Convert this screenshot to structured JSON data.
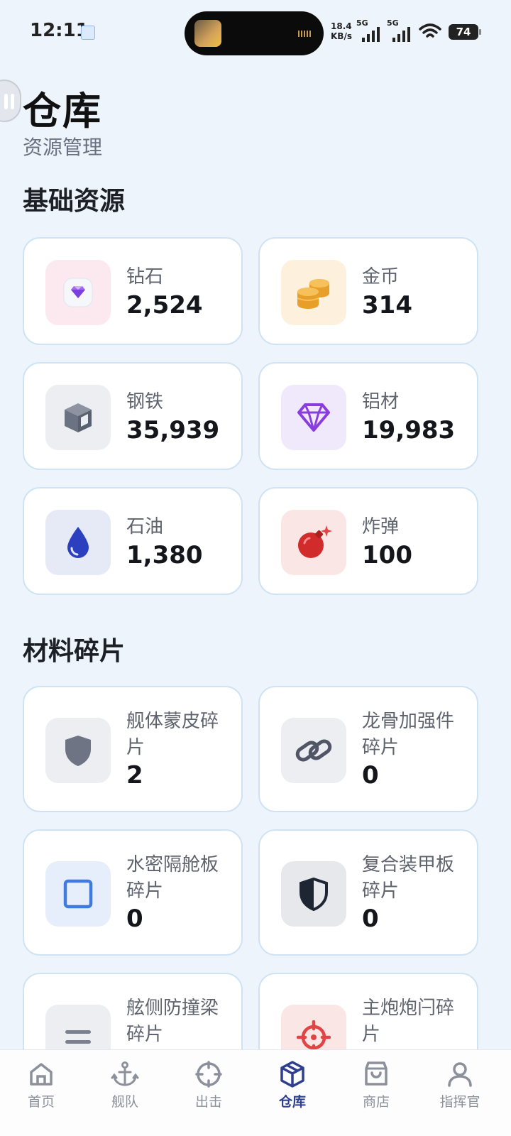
{
  "status_bar": {
    "time": "12:11",
    "net_speed_value": "18.4",
    "net_speed_unit": "KB/s",
    "sim1_type": "5G",
    "sim2_type": "5G",
    "battery": "74"
  },
  "header": {
    "title": "仓库",
    "subtitle": "资源管理"
  },
  "sections": {
    "basic": {
      "title": "基础资源",
      "items": [
        {
          "label": "钻石",
          "value": "2,524",
          "icon": "gem-icon",
          "tile_color": "#fbe9ef"
        },
        {
          "label": "金币",
          "value": "314",
          "icon": "coins-icon",
          "tile_color": "#fdf0dc"
        },
        {
          "label": "钢铁",
          "value": "35,939",
          "icon": "cube-icon",
          "tile_color": "#eceef2"
        },
        {
          "label": "铝材",
          "value": "19,983",
          "icon": "diamond-outline-icon",
          "tile_color": "#f0e8fb"
        },
        {
          "label": "石油",
          "value": "1,380",
          "icon": "oil-drop-icon",
          "tile_color": "#e6eaf7"
        },
        {
          "label": "炸弹",
          "value": "100",
          "icon": "bomb-icon",
          "tile_color": "#fbe6e6"
        }
      ]
    },
    "fragments": {
      "title": "材料碎片",
      "items": [
        {
          "label": "舰体蒙皮碎片",
          "value": "2",
          "icon": "shield-icon",
          "tile_color": "#eceef2"
        },
        {
          "label": "龙骨加强件碎片",
          "value": "0",
          "icon": "link-icon",
          "tile_color": "#eceef2"
        },
        {
          "label": "水密隔舱板碎片",
          "value": "0",
          "icon": "square-outline-icon",
          "tile_color": "#e6eefb"
        },
        {
          "label": "复合装甲板碎片",
          "value": "0",
          "icon": "half-shield-icon",
          "tile_color": "#e6e8ec"
        },
        {
          "label": "舷侧防撞梁碎片",
          "value": "",
          "icon": "equals-icon",
          "tile_color": "#eceef2"
        },
        {
          "label": "主炮炮闩碎片",
          "value": "",
          "icon": "crosshair-icon",
          "tile_color": "#fbe6e6"
        }
      ]
    }
  },
  "nav": {
    "items": [
      {
        "label": "首页",
        "icon": "home-icon"
      },
      {
        "label": "舰队",
        "icon": "anchor-icon"
      },
      {
        "label": "出击",
        "icon": "target-icon"
      },
      {
        "label": "仓库",
        "icon": "box-icon",
        "active": true
      },
      {
        "label": "商店",
        "icon": "shopping-bag-icon"
      },
      {
        "label": "指挥官",
        "icon": "user-icon"
      }
    ]
  },
  "colors": {
    "background": "#eef4fc",
    "card_border": "#cfe3f4",
    "nav_active": "#2f3f8f",
    "nav_inactive": "#8b909b"
  }
}
